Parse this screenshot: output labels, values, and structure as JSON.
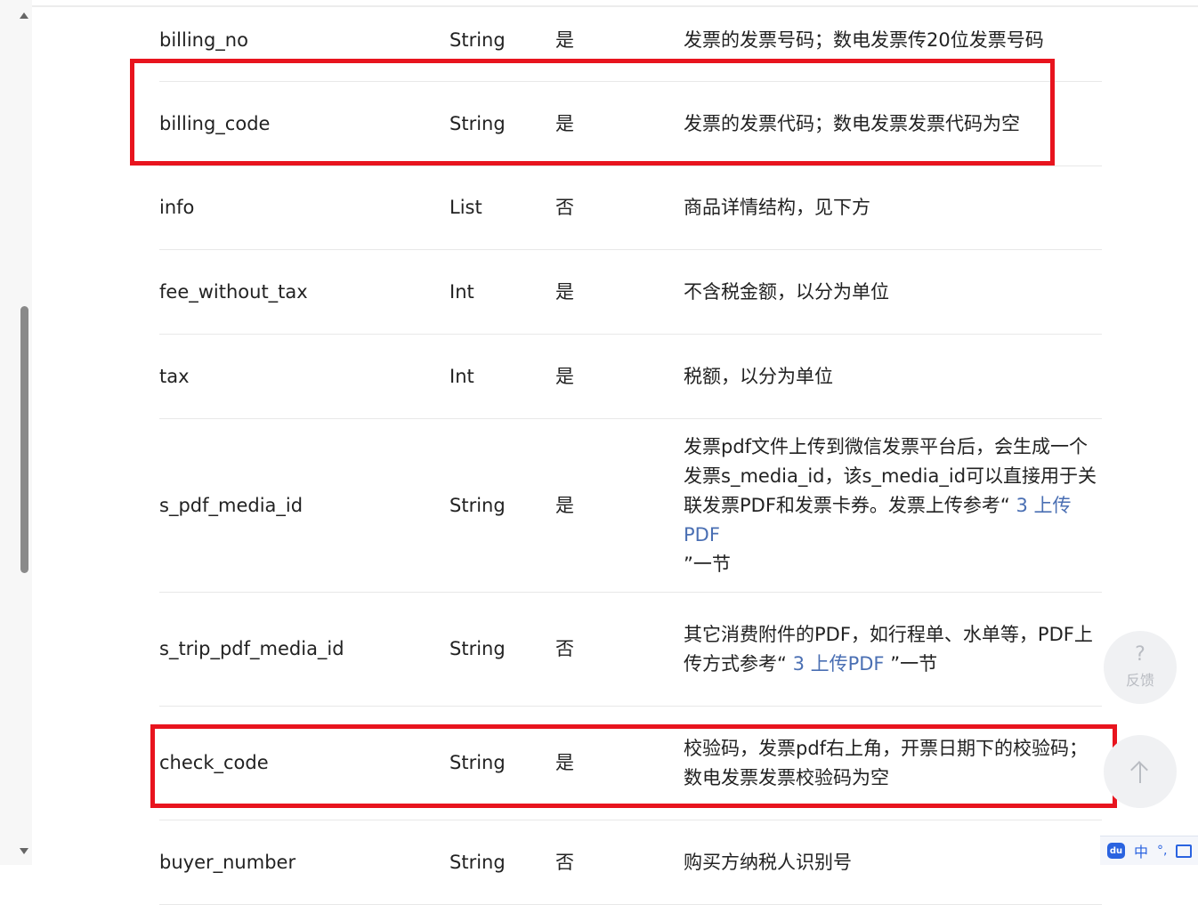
{
  "table": {
    "rows": [
      {
        "name": "billing_no",
        "type": "String",
        "required": "是",
        "desc": "发票的发票号码；数电发票传20位发票号码"
      },
      {
        "name": "billing_code",
        "type": "String",
        "required": "是",
        "desc": "发票的发票代码；数电发票发票代码为空"
      },
      {
        "name": "info",
        "type": "List",
        "required": "否",
        "desc": "商品详情结构，见下方"
      },
      {
        "name": "fee_without_tax",
        "type": "Int",
        "required": "是",
        "desc": "不含税金额，以分为单位"
      },
      {
        "name": "tax",
        "type": "Int",
        "required": "是",
        "desc": "税额，以分为单位"
      },
      {
        "name": "s_pdf_media_id",
        "type": "String",
        "required": "是",
        "desc_l1": "发票pdf文件上传到微信发票平台后，会生成一个",
        "desc_l2": "发票s_media_id，该s_media_id可以直接用于关",
        "desc_l3_pre": "联发票PDF和发票卡券。发票上传参考“ ",
        "desc_link": "3 上传PDF",
        "desc_l4": "”一节"
      },
      {
        "name": "s_trip_pdf_media_id",
        "type": "String",
        "required": "否",
        "desc_l1": "其它消费附件的PDF，如行程单、水单等，PDF上",
        "desc_l2_pre": "传方式参考“ ",
        "desc_link": "3 上传PDF",
        "desc_l2_post": " ”一节"
      },
      {
        "name": "check_code",
        "type": "String",
        "required": "是",
        "desc_l1": "校验码，发票pdf右上角，开票日期下的校验码；",
        "desc_l2": "数电发票发票校验码为空"
      },
      {
        "name": "buyer_number",
        "type": "String",
        "required": "否",
        "desc": "购买方纳税人识别号"
      }
    ]
  },
  "floating": {
    "feedback_q": "?",
    "feedback_label": "反馈"
  },
  "ime": {
    "logo": "du",
    "mode": "中",
    "punct": "°,"
  },
  "colors": {
    "highlight": "#e8141e",
    "link": "#4a6fb3"
  }
}
